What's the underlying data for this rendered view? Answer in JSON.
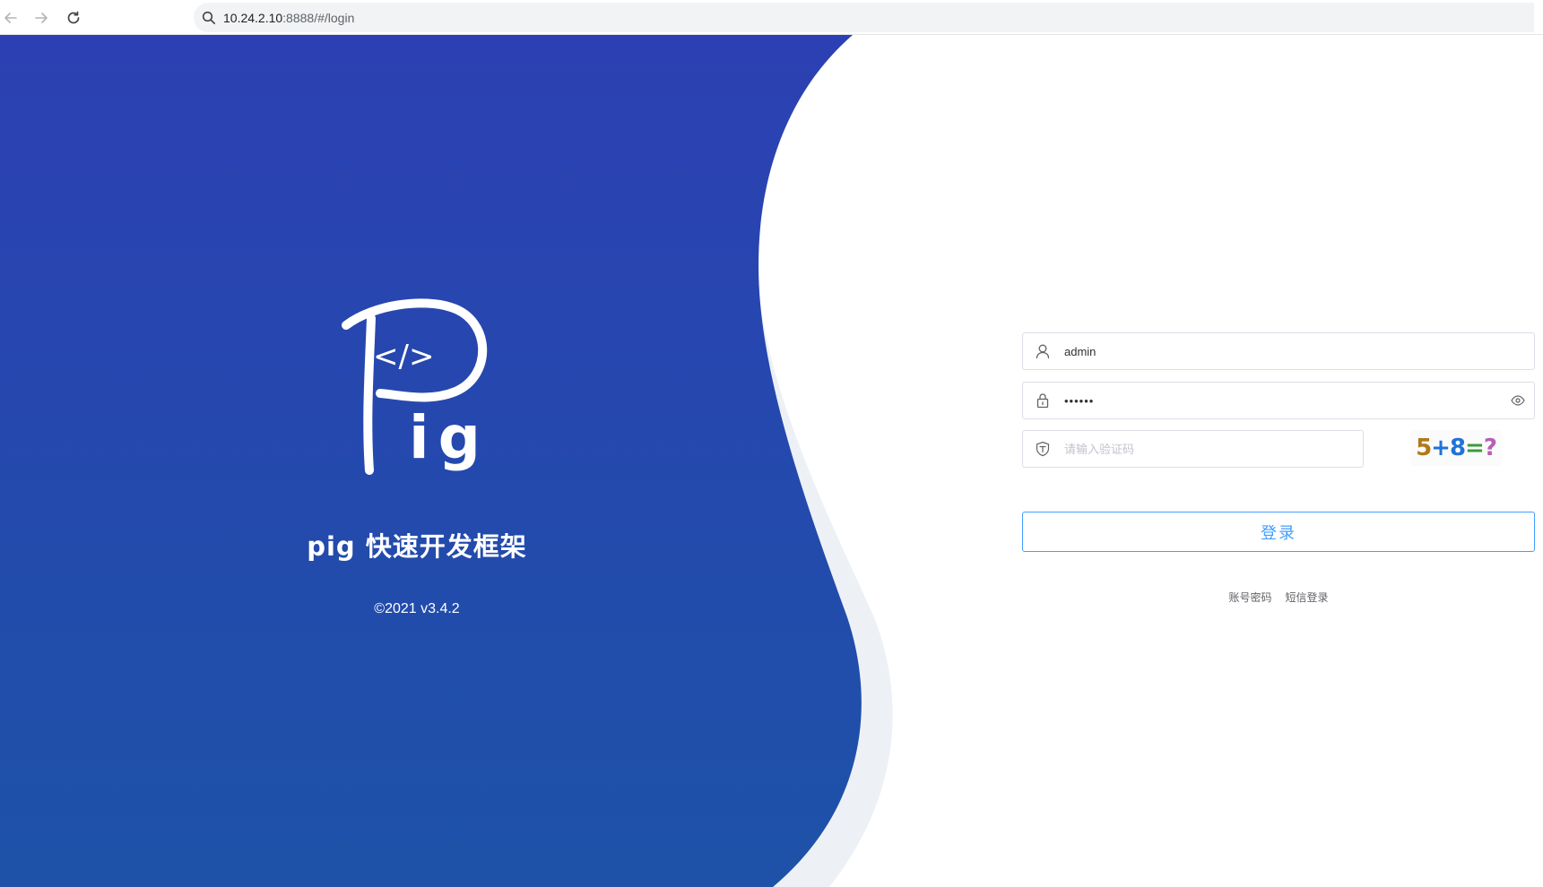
{
  "browser": {
    "url_host": "10.24.2.10",
    "url_rest": ":8888/#/login"
  },
  "brand": {
    "logo_text": "</>",
    "logo_suffix": "ig",
    "title": "pig 快速开发框架",
    "copyright": "©2021 v3.4.2"
  },
  "login": {
    "username_value": "admin",
    "password_masked": "••••••",
    "code_placeholder": "请输入验证码",
    "captcha_text": [
      "5",
      "+",
      "8",
      "=",
      "?"
    ],
    "captcha_colors": [
      "#b07a1a",
      "#1e73d8",
      "#1e73d8",
      "#3c9a3c",
      "#b55fb5"
    ],
    "submit_label": "登录",
    "tab_account": "账号密码",
    "tab_sms": "短信登录"
  },
  "colors": {
    "brand_gradient_top": "#2c40b3",
    "brand_gradient_bottom": "#1d52a8",
    "accent": "#409eff"
  }
}
